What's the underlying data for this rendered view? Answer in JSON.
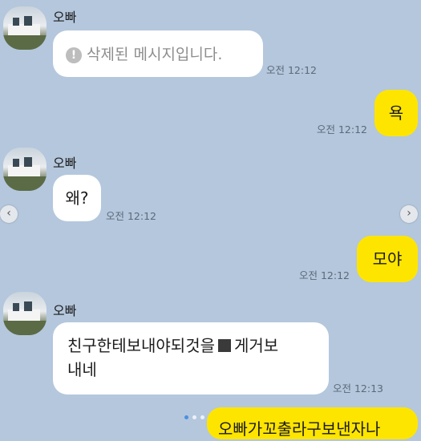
{
  "sender_name": "오빠",
  "messages": {
    "m1": {
      "text": "삭제된 메시지입니다.",
      "time": "오전 12:12"
    },
    "m2": {
      "text": "욕",
      "time": "오전 12:12"
    },
    "m3": {
      "text": "왜?",
      "time": "오전 12:12"
    },
    "m4": {
      "text": "모야",
      "time": "오전 12:12"
    },
    "m5": {
      "line1_a": "친구한테보내야되것을",
      "line1_b": "게거보",
      "line2": "내네",
      "time": "오전 12:13"
    },
    "m6": {
      "text": "오빠가꼬출라구보낸자나"
    }
  },
  "icons": {
    "info": "info-icon",
    "prev": "chevron-left-icon",
    "next": "chevron-right-icon"
  },
  "colors": {
    "background": "#b4c7dd",
    "my_bubble": "#fee500",
    "other_bubble": "#ffffff"
  }
}
